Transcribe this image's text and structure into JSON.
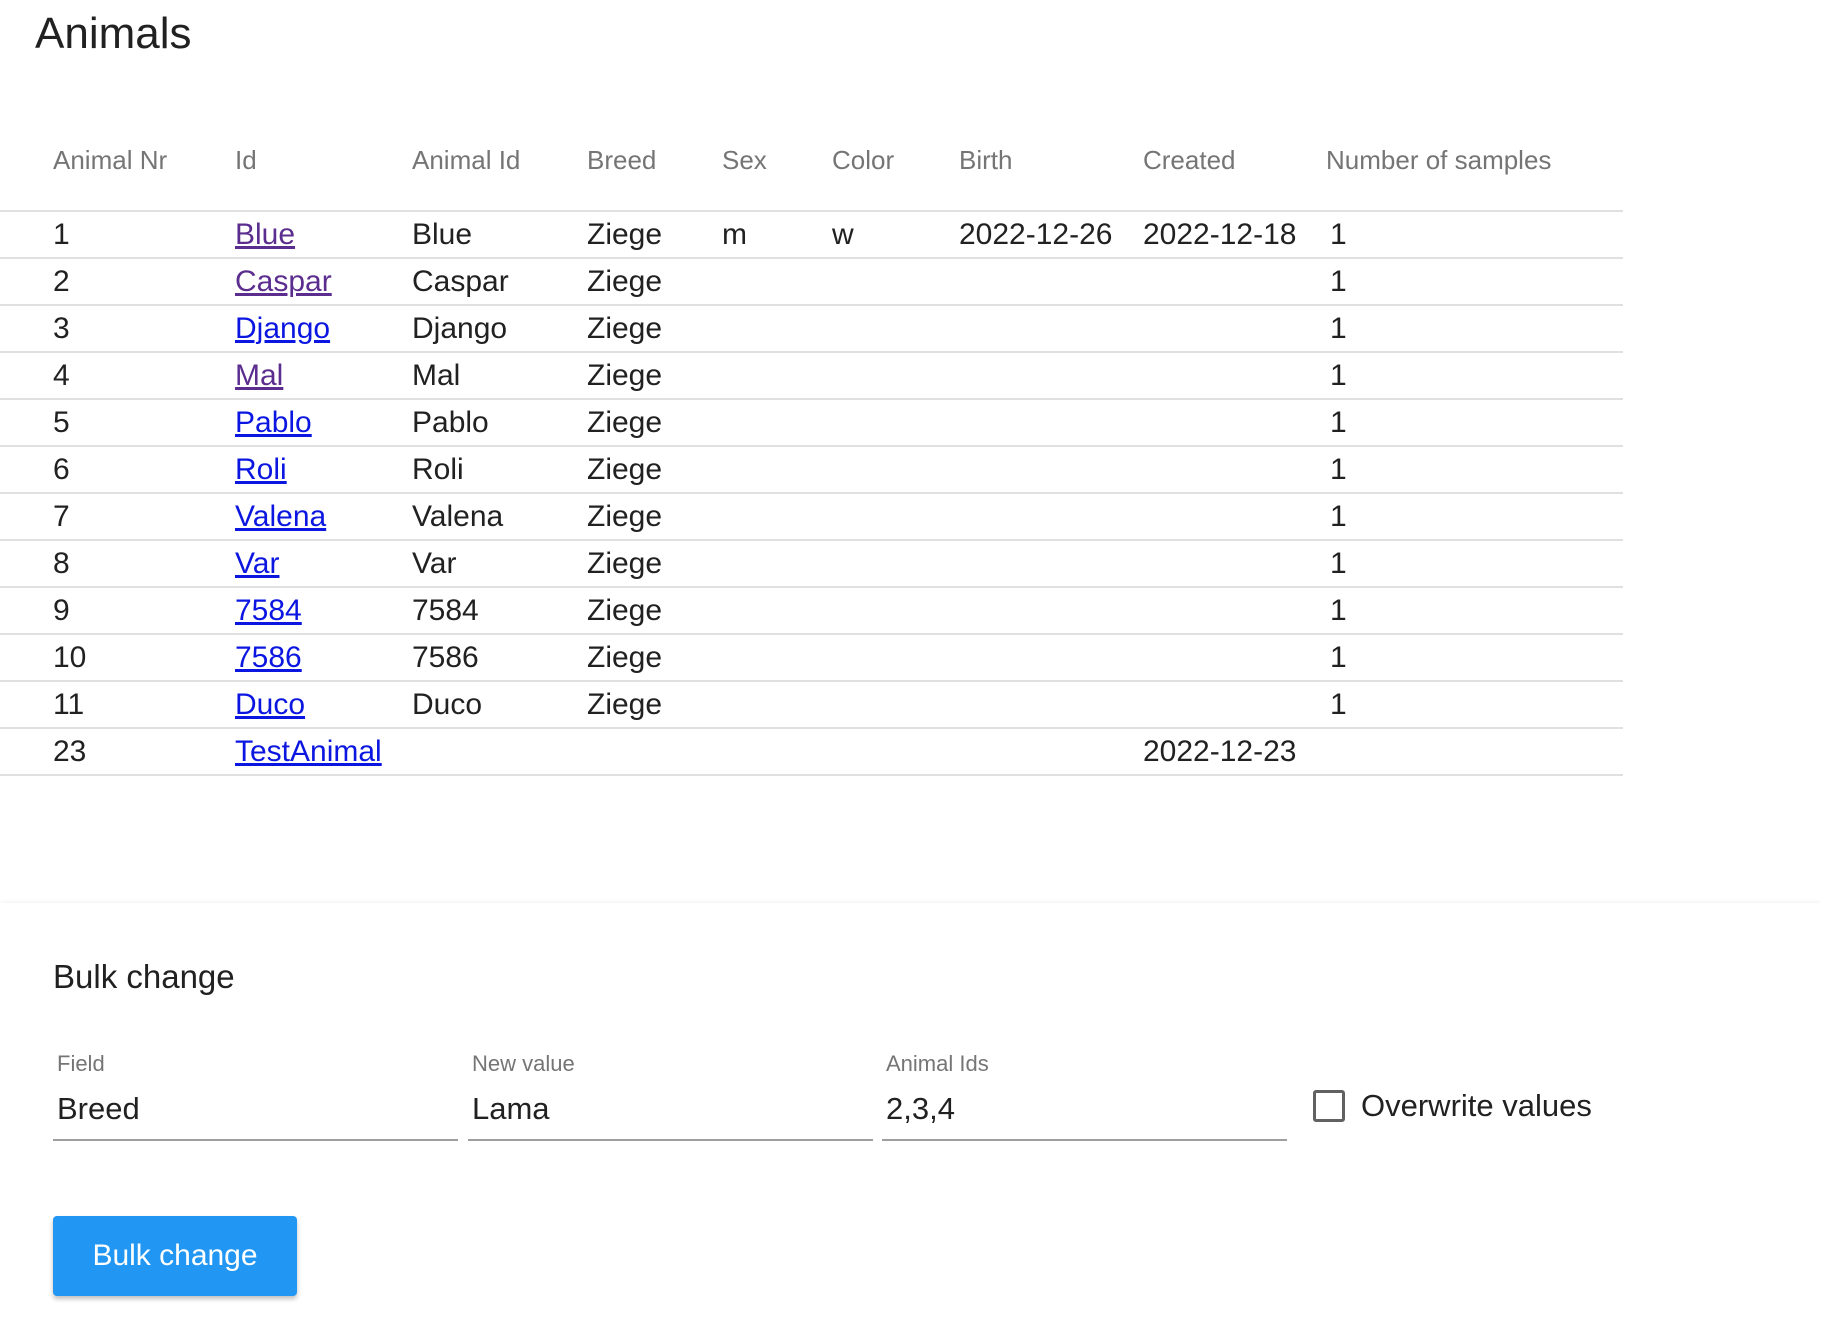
{
  "page": {
    "title": "Animals"
  },
  "table": {
    "headers": {
      "nr": "Animal Nr",
      "id": "Id",
      "animal_id": "Animal Id",
      "breed": "Breed",
      "sex": "Sex",
      "color": "Color",
      "birth": "Birth",
      "created": "Created",
      "samples": "Number of samples"
    },
    "rows": [
      {
        "nr": "1",
        "id": "Blue",
        "animal_id": "Blue",
        "breed": "Ziege",
        "sex": "m",
        "color": "w",
        "birth": "2022-12-26",
        "created": "2022-12-18",
        "samples": "1",
        "link_state": "visited"
      },
      {
        "nr": "2",
        "id": "Caspar",
        "animal_id": "Caspar",
        "breed": "Ziege",
        "sex": "",
        "color": "",
        "birth": "",
        "created": "",
        "samples": "1",
        "link_state": "visited"
      },
      {
        "nr": "3",
        "id": "Django",
        "animal_id": "Django",
        "breed": "Ziege",
        "sex": "",
        "color": "",
        "birth": "",
        "created": "",
        "samples": "1",
        "link_state": "fresh"
      },
      {
        "nr": "4",
        "id": "Mal",
        "animal_id": "Mal",
        "breed": "Ziege",
        "sex": "",
        "color": "",
        "birth": "",
        "created": "",
        "samples": "1",
        "link_state": "visited"
      },
      {
        "nr": "5",
        "id": "Pablo",
        "animal_id": "Pablo",
        "breed": "Ziege",
        "sex": "",
        "color": "",
        "birth": "",
        "created": "",
        "samples": "1",
        "link_state": "fresh"
      },
      {
        "nr": "6",
        "id": "Roli",
        "animal_id": "Roli",
        "breed": "Ziege",
        "sex": "",
        "color": "",
        "birth": "",
        "created": "",
        "samples": "1",
        "link_state": "fresh"
      },
      {
        "nr": "7",
        "id": "Valena",
        "animal_id": "Valena",
        "breed": "Ziege",
        "sex": "",
        "color": "",
        "birth": "",
        "created": "",
        "samples": "1",
        "link_state": "fresh"
      },
      {
        "nr": "8",
        "id": "Var",
        "animal_id": "Var",
        "breed": "Ziege",
        "sex": "",
        "color": "",
        "birth": "",
        "created": "",
        "samples": "1",
        "link_state": "fresh"
      },
      {
        "nr": "9",
        "id": "7584",
        "animal_id": "7584",
        "breed": "Ziege",
        "sex": "",
        "color": "",
        "birth": "",
        "created": "",
        "samples": "1",
        "link_state": "fresh"
      },
      {
        "nr": "10",
        "id": "7586",
        "animal_id": "7586",
        "breed": "Ziege",
        "sex": "",
        "color": "",
        "birth": "",
        "created": "",
        "samples": "1",
        "link_state": "fresh"
      },
      {
        "nr": "11",
        "id": "Duco",
        "animal_id": "Duco",
        "breed": "Ziege",
        "sex": "",
        "color": "",
        "birth": "",
        "created": "",
        "samples": "1",
        "link_state": "fresh"
      },
      {
        "nr": "23",
        "id": "TestAnimal",
        "animal_id": "",
        "breed": "",
        "sex": "",
        "color": "",
        "birth": "",
        "created": "2022-12-23",
        "samples": "",
        "link_state": "fresh"
      }
    ]
  },
  "bulk_change": {
    "title": "Bulk change",
    "field_label": "Field",
    "field_value": "Breed",
    "new_value_label": "New value",
    "new_value_value": "Lama",
    "animal_ids_label": "Animal Ids",
    "animal_ids_value": "2,3,4",
    "overwrite_label": "Overwrite values",
    "overwrite_checked": false,
    "button_label": "Bulk change"
  },
  "colors": {
    "link_visited": "#5b2d8e",
    "link_fresh": "#0b16e0",
    "button_primary": "#2196f3",
    "header_text": "#757575",
    "row_divider": "#e0e0e0"
  }
}
